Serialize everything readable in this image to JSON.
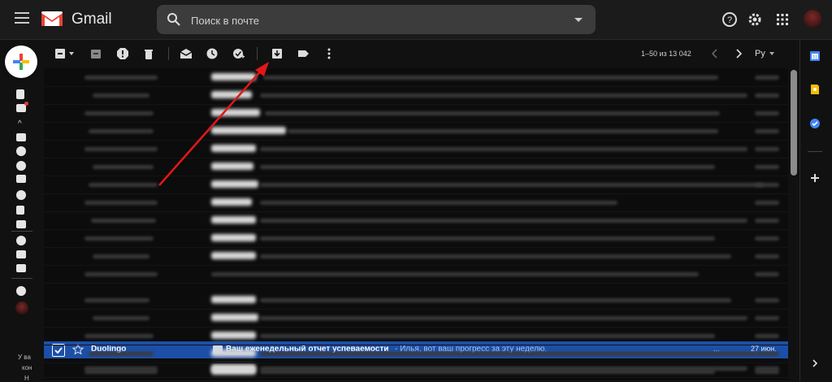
{
  "app": {
    "title": "Gmail"
  },
  "search": {
    "placeholder": "Поиск в почте"
  },
  "toolbar": {
    "pagination": "1–50 из 13 042",
    "language": "Ру"
  },
  "leftnav": {
    "bottom_text": [
      "У ва",
      "кон",
      "Н"
    ]
  },
  "selected_row": {
    "sender": "Duolingo",
    "subject": "Ваш еженедельный отчет успеваемости",
    "snippet": "- Илья, вот ваш прогресс за эту неделю.",
    "ellipsis": "...",
    "date": "27 июн."
  },
  "colors": {
    "selected_row": "#1c4fa8",
    "annotation_arrow": "#e01818",
    "gmail_red": "#ea4335"
  },
  "icons": [
    "menu-icon",
    "search-icon",
    "help-icon",
    "settings-icon",
    "apps-icon",
    "archive-icon",
    "spam-icon",
    "delete-icon",
    "mark-read-icon",
    "snooze-icon",
    "add-task-icon",
    "move-to-icon",
    "label-icon",
    "more-icon"
  ]
}
